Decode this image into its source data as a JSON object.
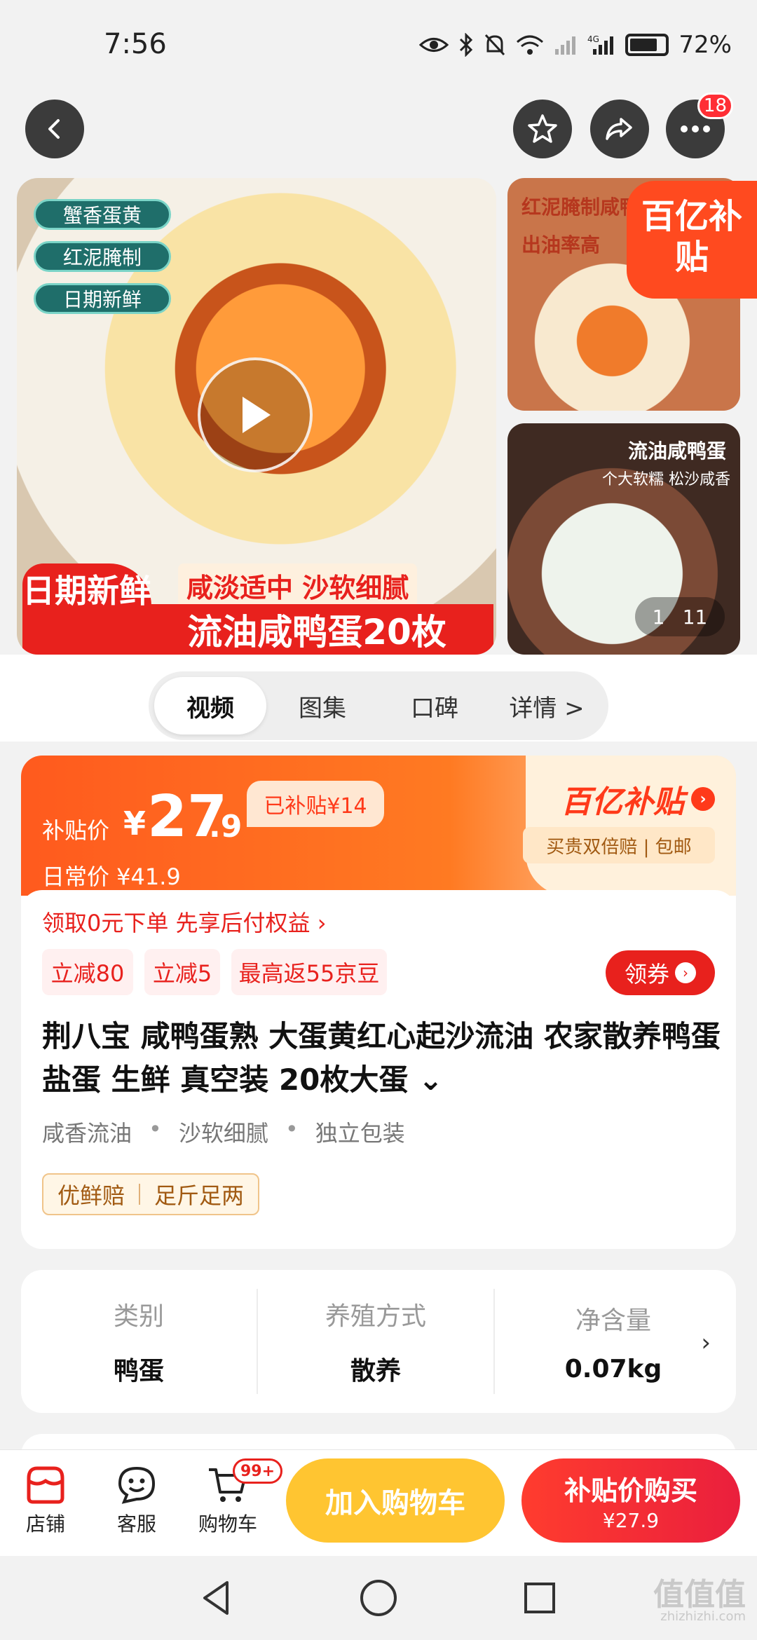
{
  "status_bar": {
    "time": "7:56",
    "battery": "72%"
  },
  "top_nav": {
    "notification_count": "18"
  },
  "media": {
    "main_tags": [
      "蟹香蛋黄",
      "红泥腌制",
      "日期新鲜"
    ],
    "banner_date": "日期新鲜",
    "banner_sub": "咸淡适中 沙软细腻",
    "banner_main": "流油咸鸭蛋20枚",
    "side1_line1": "红泥腌制咸鸭蛋",
    "side1_line2": "出油率高",
    "subsidy_badge": "百亿补贴",
    "side2_line1": "流油咸鸭蛋",
    "side2_line2": "个大软糯 松沙咸香",
    "counter_current": "1",
    "counter_total": "11"
  },
  "tabs": [
    "视频",
    "图集",
    "口碑",
    "详情 >"
  ],
  "price": {
    "label": "补贴价",
    "yen": "¥",
    "integer": "27",
    "decimal": ".9",
    "subsidized": "已补贴¥14",
    "daily": "日常价 ¥41.9",
    "brand": "百亿补贴",
    "brand_arrow": "›",
    "brand_sub": "买贵双倍赔 | 包邮"
  },
  "promo": {
    "line": "领取0元下单 先享后付权益 ›",
    "chips": [
      "立减80",
      "立减5",
      "最高返55京豆"
    ],
    "coupon_label": "领券",
    "coupon_arrow": "›"
  },
  "product": {
    "title": "荆八宝 咸鸭蛋熟 大蛋黄红心起沙流油 农家散养鸭蛋盐蛋 生鲜 真空装 20枚大蛋 ⌄",
    "features": [
      "咸香流油",
      "沙软细腻",
      "独立包装"
    ],
    "feature_dot": "•",
    "guarantees": [
      "优鲜赔",
      "足斤足两"
    ]
  },
  "specs": [
    {
      "label": "类别",
      "value": "鸭蛋"
    },
    {
      "label": "养殖方式",
      "value": "散养"
    },
    {
      "label": "净含量",
      "value": "0.07kg"
    }
  ],
  "spec_chevron": "›",
  "bottom_bar": {
    "store": "店铺",
    "service": "客服",
    "cart": "购物车",
    "cart_badge": "99+",
    "add_to_cart": "加入购物车",
    "buy_label": "补贴价购买",
    "buy_price": "¥27.9"
  },
  "watermark": {
    "main": "值值值",
    "sub": "zhizhizhi.com"
  },
  "colors": {
    "accent_red": "#e8211d",
    "accent_orange": "#ff5a1e",
    "cart_yellow": "#ffc531"
  }
}
